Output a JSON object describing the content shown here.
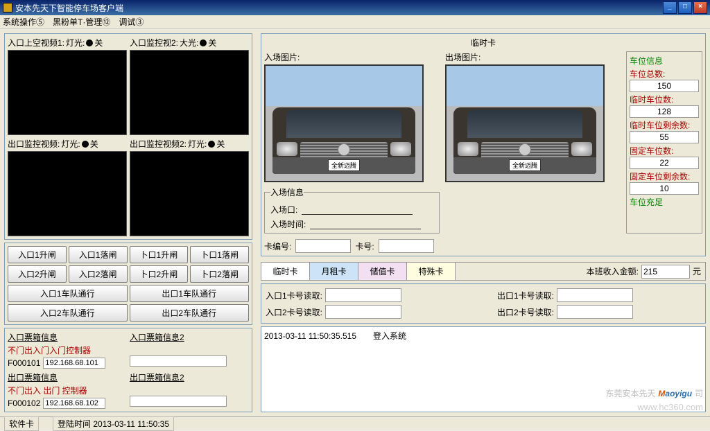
{
  "window": {
    "title": "安本先天下智能停车场客户端"
  },
  "menu": {
    "m1": "系统操作⑤",
    "m2": "黑粉单T·管理⑫",
    "m3": "调试③"
  },
  "videos": {
    "v1": {
      "prefix": "入口上空视频1:",
      "light": "灯光:",
      "state": "关"
    },
    "v2": {
      "prefix": "入口监控视2:",
      "light": "大光:",
      "state": "关"
    },
    "v3": {
      "prefix": "出口监控视频:",
      "light": "灯光:",
      "state": "关"
    },
    "v4": {
      "prefix": "出口监控视频2:",
      "light": "灯光:",
      "state": "关"
    }
  },
  "buttons": {
    "b1": "入口1升闸",
    "b2": "入口1落闸",
    "b3": "卜口1升闸",
    "b4": "卜口1落闸",
    "b5": "入口2升闸",
    "b6": "入口2落闸",
    "b7": "卜口2升闸",
    "b8": "卜口2落闸",
    "b9": "入口1车队通行",
    "b10": "出口1车队通行",
    "b11": "入口2车队通行",
    "b12": "出口2车队通行"
  },
  "info": {
    "lh1": "入口票箱信息",
    "l1a": "不门出入门入门控制器",
    "l1b": "F000101",
    "l1c": "192.168.68.101",
    "lh2": "出口票箱信息",
    "l2a": "不门出入 出门 控制器",
    "l2b": "F000102",
    "l2c": "192.168.68.102",
    "rh1": "入口票箱信息2",
    "rh2": "出口票箱信息2"
  },
  "card": {
    "title": "临时卡",
    "photo_in_label": "入场图片:",
    "photo_out_label": "出场图片:",
    "plate_text": "全新迈腾"
  },
  "stats": {
    "title": "车位信息",
    "f1l": "车位总数:",
    "f1v": "150",
    "f2l": "临时车位数:",
    "f2v": "128",
    "f3l": "临时车位剩余数:",
    "f3v": "55",
    "f4l": "固定车位数:",
    "f4v": "22",
    "f5l": "固定车位剩余数:",
    "f5v": "10",
    "f6l": "车位充足"
  },
  "entry": {
    "legend": "入场信息",
    "f1": "入场口:",
    "f2": "入场时间:"
  },
  "cardno": {
    "l1": "卡编号:",
    "l2": "卡号:"
  },
  "tabs": {
    "t1": "临时卡",
    "t2": "月租卡",
    "t3": "储值卡",
    "t4": "特殊卡",
    "income_l": "本班收入金额:",
    "income_v": "215",
    "yuan": "元"
  },
  "reader": {
    "r1": "入口1卡号读取:",
    "r2": "出口1卡号读取:",
    "r3": "入口2卡号读取:",
    "r4": "出口2卡号读取:"
  },
  "log": {
    "line": "2013-03-11 11:50:35.515　　登入系统"
  },
  "status": {
    "s1": "软件卡",
    "s2l": "登陆时间",
    "s2v": "2013-03-11 11:50:35"
  },
  "watermark": {
    "cn": "东莞安本先天",
    "suffix": "司",
    "url": "www.hc360.com"
  }
}
